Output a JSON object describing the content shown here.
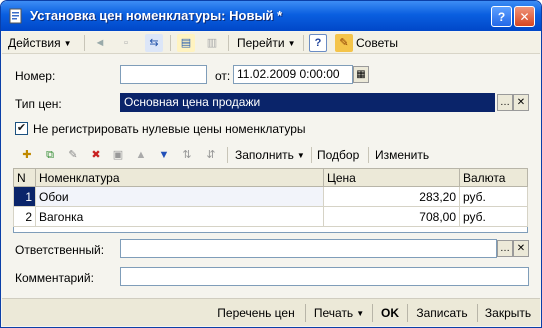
{
  "window": {
    "title": "Установка цен номенклатуры: Новый *",
    "help_glyph": "?",
    "close_glyph": "✕"
  },
  "toolbar": {
    "actions_label": "Действия",
    "goto_label": "Перейти",
    "help_glyph": "?",
    "tips_label": "Советы"
  },
  "form": {
    "number_label": "Номер:",
    "number_value": "",
    "date_label": "от:",
    "date_value": "11.02.2009  0:00:00",
    "price_type_label": "Тип цен:",
    "price_type_value": "Основная цена продажи",
    "no_zero_prices_label": "Не регистрировать нулевые цены номенклатуры",
    "no_zero_prices_checked": true,
    "responsible_label": "Ответственный:",
    "responsible_value": "",
    "comment_label": "Комментарий:",
    "comment_value": ""
  },
  "grid_toolbar": {
    "fill_label": "Заполнить",
    "pick_label": "Подбор",
    "change_label": "Изменить"
  },
  "grid": {
    "columns": [
      "N",
      "Номенклатура",
      "Цена",
      "Валюта"
    ],
    "rows": [
      {
        "n": "1",
        "item": "Обои",
        "price": "283,20",
        "currency": "руб."
      },
      {
        "n": "2",
        "item": "Вагонка",
        "price": "708,00",
        "currency": "руб."
      }
    ]
  },
  "bottom": {
    "price_list_label": "Перечень цен",
    "print_label": "Печать",
    "ok_label": "OK",
    "save_label": "Записать",
    "close_label": "Закрыть"
  },
  "colors": {
    "titlebar": "#0a5fe0",
    "selection": "#0a246a",
    "window_bg": "#f5f4ee"
  }
}
